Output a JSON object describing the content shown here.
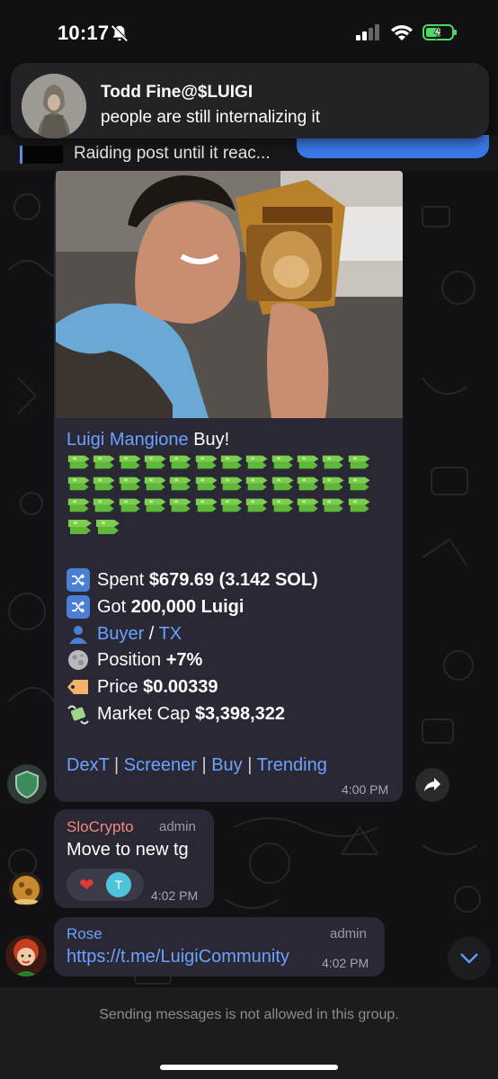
{
  "status_bar": {
    "time": "10:17"
  },
  "notification": {
    "title": "Todd Fine@$LUIGI",
    "body": "people are still internalizing it"
  },
  "pinned": {
    "text": "Raiding post until it reac..."
  },
  "message": {
    "sender_link": "Luigi Mangione",
    "title_suffix": " Buy!",
    "money_emoji_rows": [
      12,
      12,
      12,
      2
    ],
    "stats": [
      {
        "icon": "shuffle-icon",
        "label": "Spent ",
        "value": "$679.69 (3.142 SOL)"
      },
      {
        "icon": "shuffle-icon",
        "label": "Got ",
        "value": "200,000 Luigi"
      },
      {
        "icon": "person-icon",
        "link1": "Buyer",
        "sep": " / ",
        "link2": "TX"
      },
      {
        "icon": "moon-icon",
        "label": "Position ",
        "value": "+7%"
      },
      {
        "icon": "price-tag-icon",
        "label": "Price ",
        "value": "$0.00339"
      },
      {
        "icon": "flying-money-icon",
        "label": "Market Cap ",
        "value": "$3,398,322"
      }
    ],
    "links": [
      "DexT",
      "Screener",
      "Buy",
      "Trending"
    ],
    "link_sep": " | ",
    "time": "4:00 PM"
  },
  "message2": {
    "sender": "SloCrypto",
    "role": "admin",
    "text": "Move to new tg",
    "reaction_user_initial": "T",
    "time": "4:02 PM"
  },
  "message3": {
    "sender": "Rose",
    "role": "admin",
    "text": "https://t.me/LuigiCommunity",
    "time": "4:02 PM"
  },
  "footer": {
    "text": "Sending messages is not allowed in this group."
  },
  "colors": {
    "link": "#6aa2ff",
    "bubble": "#2a2835",
    "admin_name": "#f08a7e",
    "rose_name": "#6aa2ff"
  }
}
